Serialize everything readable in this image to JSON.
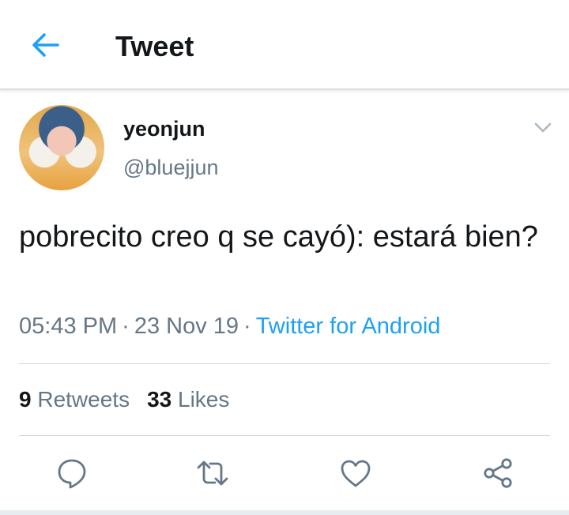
{
  "header": {
    "title": "Tweet",
    "back_icon": "arrow-left-icon"
  },
  "tweet": {
    "author": {
      "name": "yeonjun",
      "handle": "@bluejjun"
    },
    "text": "pobrecito creo q se cayó): estará bien?",
    "time": "05:43 PM",
    "date": "23 Nov 19",
    "source": "Twitter for Android",
    "retweets": {
      "count": "9",
      "label": "Retweets"
    },
    "likes": {
      "count": "33",
      "label": "Likes"
    }
  },
  "actions": [
    "reply-icon",
    "retweet-icon",
    "like-icon",
    "share-icon"
  ],
  "colors": {
    "accent": "#1da1f2",
    "secondary_text": "#657786",
    "primary_text": "#14171a",
    "icon": "#657786"
  }
}
